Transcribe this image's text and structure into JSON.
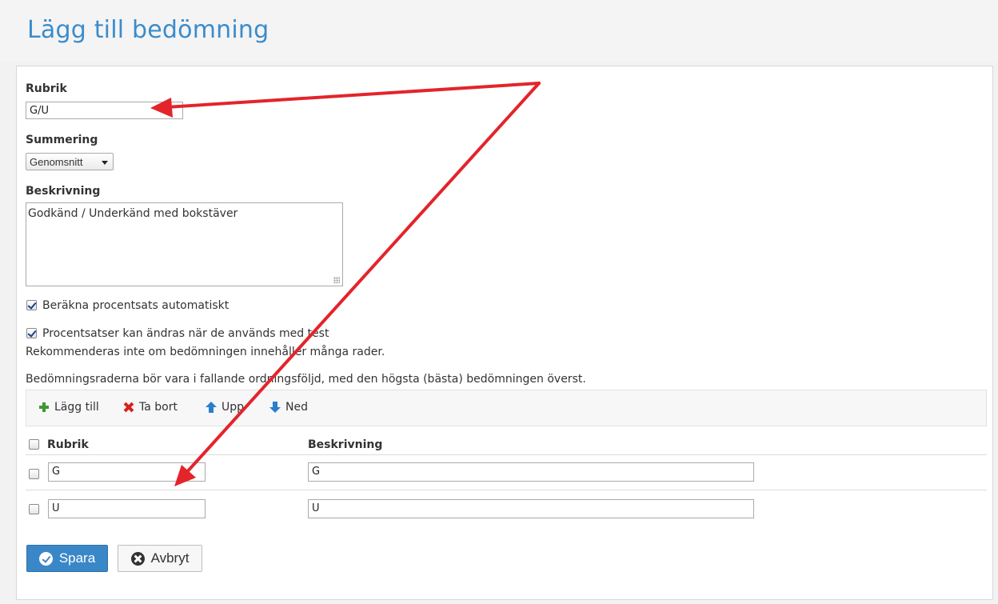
{
  "page": {
    "title": "Lägg till bedömning"
  },
  "form": {
    "rubrik_label": "Rubrik",
    "rubrik_value": "G/U",
    "summering_label": "Summering",
    "summering_value": "Genomsnitt",
    "beskrivning_label": "Beskrivning",
    "beskrivning_value": "Godkänd / Underkänd med bokstäver",
    "auto_percent_label": "Beräkna procentsats automatiskt",
    "auto_percent_checked": true,
    "editable_percent_label": "Procentsatser kan ändras när de används med test",
    "editable_percent_checked": true,
    "editable_percent_hint": "Rekommenderas inte om bedömningen innehåller många rader.",
    "rows_hint": "Bedömningsraderna bör vara i fallande ordningsföljd, med den högsta (bästa) bedömningen överst."
  },
  "toolbar": {
    "add_label": "Lägg till",
    "remove_label": "Ta bort",
    "up_label": "Upp",
    "down_label": "Ned"
  },
  "table": {
    "headers": {
      "rubrik": "Rubrik",
      "beskrivning": "Beskrivning"
    },
    "rows": [
      {
        "rubrik": "G",
        "beskrivning": "G"
      },
      {
        "rubrik": "U",
        "beskrivning": "U"
      }
    ]
  },
  "actions": {
    "save_label": "Spara",
    "cancel_label": "Avbryt"
  },
  "colors": {
    "title": "#3a8ccc",
    "primary": "#3a87c8",
    "annotation_arrow": "#e3242b"
  }
}
